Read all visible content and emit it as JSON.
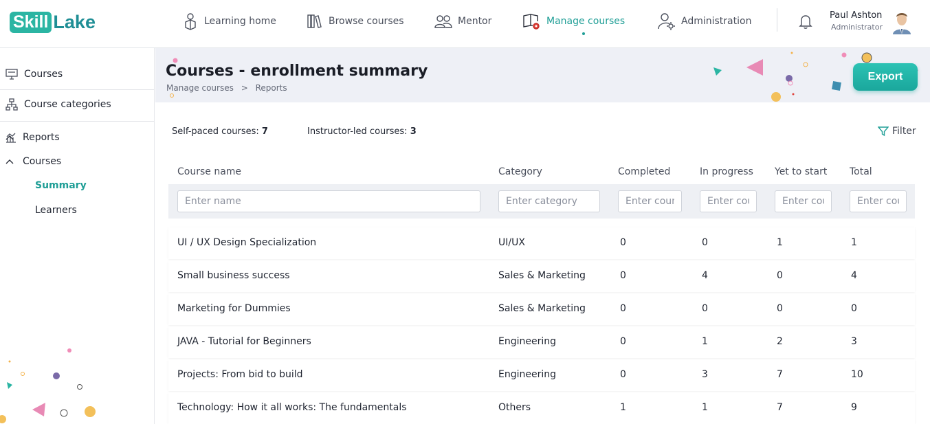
{
  "brand": {
    "part1": "Skill",
    "part2": "Lake"
  },
  "nav": {
    "items": [
      {
        "label": "Learning home",
        "icon": "learning-home-icon"
      },
      {
        "label": "Browse courses",
        "icon": "books-icon"
      },
      {
        "label": "Mentor",
        "icon": "mentor-icon"
      },
      {
        "label": "Manage courses",
        "icon": "manage-courses-icon",
        "active": true
      },
      {
        "label": "Administration",
        "icon": "admin-user-gear-icon"
      }
    ]
  },
  "user": {
    "name": "Paul Ashton",
    "role": "Administrator"
  },
  "sidebar": {
    "items": [
      {
        "label": "Courses"
      },
      {
        "label": "Course categories"
      },
      {
        "label": "Reports"
      }
    ],
    "reports_sub": {
      "courses": "Courses",
      "summary": "Summary",
      "learners": "Learners"
    }
  },
  "page": {
    "title": "Courses - enrollment summary",
    "breadcrumb": {
      "parent": "Manage courses",
      "separator": ">",
      "current": "Reports"
    },
    "export_label": "Export"
  },
  "summary": {
    "self_paced_label": "Self-paced courses:",
    "self_paced_count": "7",
    "instructor_led_label": "Instructor-led courses:",
    "instructor_led_count": "3",
    "filter_label": "Filter"
  },
  "table": {
    "columns": [
      "Course name",
      "Category",
      "Completed",
      "In progress",
      "Yet to start",
      "Total"
    ],
    "placeholders": [
      "Enter name",
      "Enter category",
      "Enter count",
      "Enter count",
      "Enter count",
      "Enter count"
    ],
    "rows": [
      [
        "UI / UX Design Specialization",
        "UI/UX",
        "0",
        "0",
        "1",
        "1"
      ],
      [
        "Small business success",
        "Sales & Marketing",
        "0",
        "4",
        "0",
        "4"
      ],
      [
        "Marketing for Dummies",
        "Sales & Marketing",
        "0",
        "0",
        "0",
        "0"
      ],
      [
        "JAVA - Tutorial for Beginners",
        "Engineering",
        "0",
        "1",
        "2",
        "3"
      ],
      [
        "Projects: From bid to build",
        "Engineering",
        "0",
        "3",
        "7",
        "10"
      ],
      [
        "Technology: How it all works: The fundamentals",
        "Others",
        "1",
        "1",
        "7",
        "9"
      ]
    ]
  },
  "colors": {
    "accent": "#1f9e96",
    "export": "#1fb0a3",
    "band": "#eef0f6"
  }
}
